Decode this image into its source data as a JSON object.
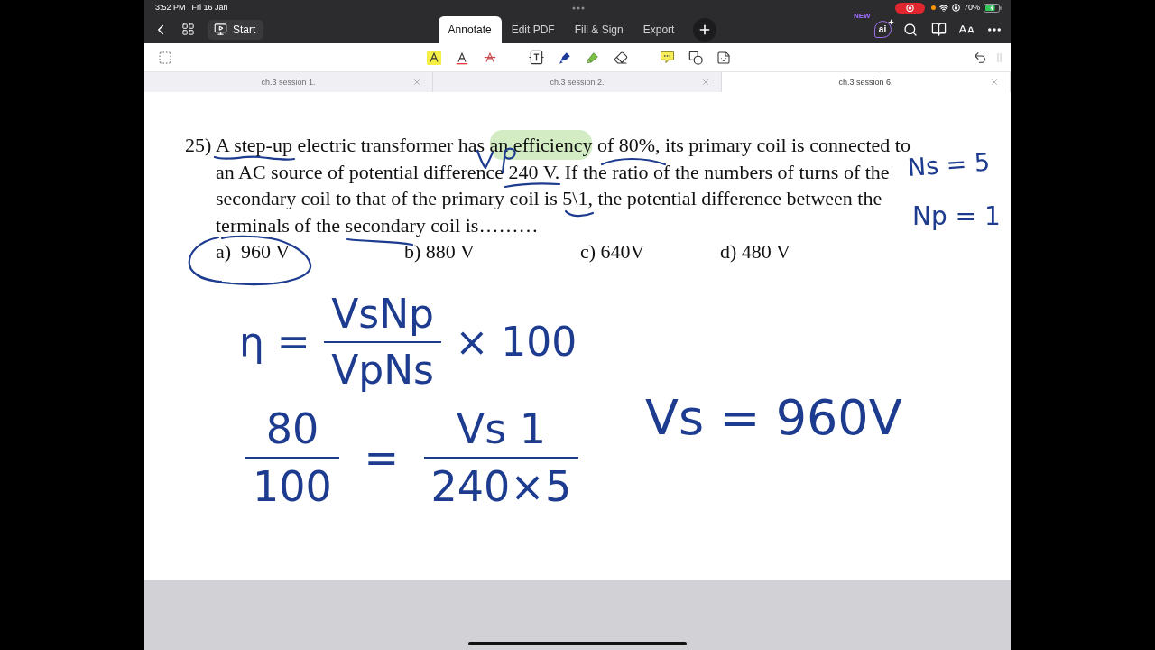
{
  "status_bar": {
    "time": "3:52 PM",
    "date": "Fri 16 Jan",
    "battery": "70%"
  },
  "nav": {
    "start_button": "Start",
    "tabs": [
      {
        "label": "Annotate",
        "selected": true
      },
      {
        "label": "Edit PDF",
        "selected": false
      },
      {
        "label": "Fill & Sign",
        "selected": false
      },
      {
        "label": "Export",
        "selected": false
      }
    ],
    "new_badge": "NEW",
    "ai_button": "ai"
  },
  "document_tabs": [
    {
      "title": "ch.3 session 1.",
      "selected": false
    },
    {
      "title": "ch.3 session 2.",
      "selected": false
    },
    {
      "title": "ch.3 session 6.",
      "selected": true
    }
  ],
  "question": {
    "number": "25)",
    "lines": [
      {
        "segments": [
          {
            "text": "A step-up electric transformer has ",
            "highlighted": false
          },
          {
            "text": "an efficiency",
            "highlighted": true
          },
          {
            "text": " of 80%, its primary coil is connected to",
            "highlighted": false
          }
        ]
      },
      {
        "segments": [
          {
            "text": "an AC source of potential difference 240 V. If the ratio of the numbers of turns of the",
            "highlighted": false
          }
        ]
      },
      {
        "segments": [
          {
            "text": "secondary coil to that of the primary coil is 5\\1, the potential difference between the",
            "highlighted": false
          }
        ]
      },
      {
        "segments": [
          {
            "text": "terminals of the secondary coil is………",
            "highlighted": false
          }
        ]
      }
    ],
    "options": [
      "a)  960 V",
      "b) 880 V",
      "c) 640V",
      "d) 480 V"
    ]
  },
  "handwriting": [
    {
      "kind": "text",
      "text": "Ns = 5"
    },
    {
      "kind": "text",
      "text": "Np = 1"
    },
    {
      "kind": "equation",
      "parts": [
        {
          "kind": "text",
          "text": "η ="
        },
        {
          "kind": "fraction",
          "numerator": "VsNp",
          "denominator": "VpNs"
        },
        {
          "kind": "text",
          "text": "× 100"
        }
      ]
    },
    {
      "kind": "equation",
      "parts": [
        {
          "kind": "fraction",
          "numerator": "80",
          "denominator": "100"
        },
        {
          "kind": "text",
          "text": "="
        },
        {
          "kind": "fraction",
          "numerator": "Vs 1",
          "denominator": "240×5"
        }
      ]
    },
    {
      "kind": "text",
      "text": "Vs = 960V"
    }
  ]
}
